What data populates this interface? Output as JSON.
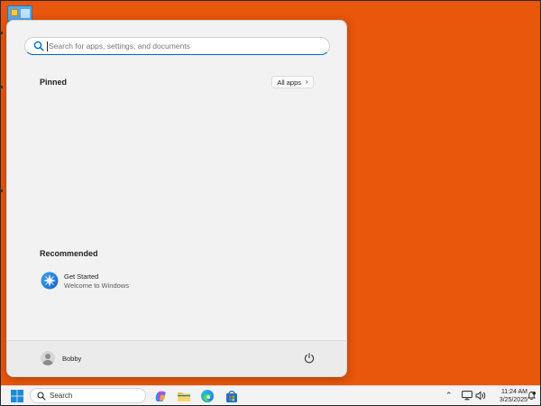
{
  "start_menu": {
    "search": {
      "placeholder": "Search for apps, settings, and documents"
    },
    "pinned": {
      "title": "Pinned",
      "all_apps_label": "All apps"
    },
    "recommended": {
      "title": "Recommended",
      "items": [
        {
          "title": "Get Started",
          "subtitle": "Welcome to Windows",
          "icon": "get-started-icon"
        }
      ]
    },
    "user": {
      "name": "Bobby"
    }
  },
  "taskbar": {
    "search_label": "Search",
    "apps": [
      "start-icon",
      "copilot-icon",
      "file-explorer-icon",
      "edge-icon",
      "store-icon"
    ],
    "tray": {
      "time": "11:24 AM",
      "date": "3/25/2025"
    }
  },
  "colors": {
    "desktop_background": "#e8570b",
    "accent": "#0067c0",
    "start_menu_bg": "#f2f2f2",
    "taskbar_bg": "#f3f3f3"
  }
}
